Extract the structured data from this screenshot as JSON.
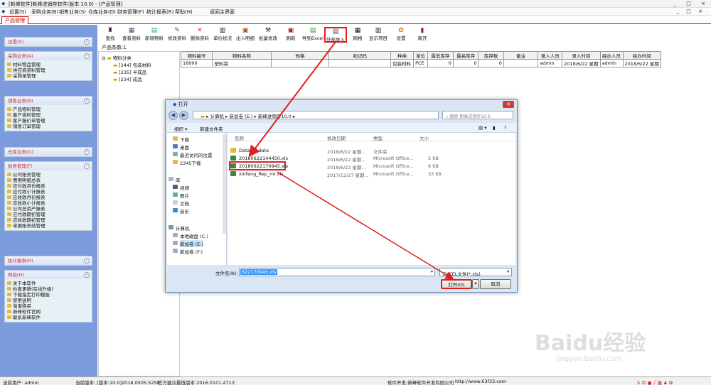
{
  "app": {
    "title": "[新峰软件]新峰进销存软件(版本:10.0) - [产品管理]",
    "window_buttons": "_ □ ×"
  },
  "menu": [
    "设置(S)",
    "采购业务(B)",
    "销售业务(S)",
    "仓库业务(D)",
    "财务管理(F)",
    "统计报表(R)",
    "帮助(H)",
    "返回主界面"
  ],
  "tab": "产品管理",
  "sidebar": {
    "sections": [
      {
        "title": "设置(S)",
        "items": []
      },
      {
        "title": "采购业务(A)",
        "items": [
          "材料物品管理",
          "供应商资料管理",
          "采购单管理"
        ]
      },
      {
        "title": "销售业务(B)",
        "items": [
          "产品物料管理",
          "客户资料管理",
          "客户报价单管理",
          "销售订单管理"
        ]
      },
      {
        "title": "仓库业务(D)",
        "items": []
      },
      {
        "title": "财务管理(F)",
        "items": [
          "公司账务管理",
          "费用明细总表",
          "应付款月份报表",
          "应付款小计报表",
          "应收款月份报表",
          "应收款小计报表",
          "公司总资产报表",
          "应付款期初管理",
          "应收款期初管理",
          "单据账务结管理"
        ]
      },
      {
        "title": "统计报表(R)",
        "items": []
      },
      {
        "title": "帮助(H)",
        "items": [
          "关于本软件",
          "检查更新(在线升级)",
          "下载指定打印模板",
          "使用说明",
          "淘宝购买",
          "新峰软件官网",
          "联系新峰软件"
        ]
      }
    ]
  },
  "toolbar": [
    "查找",
    "查看资料",
    "新增物料",
    "修改资料",
    "删除资料",
    "单价状况",
    "出入明细",
    "批量修改",
    "刷新",
    "导到Excel",
    "外部导入",
    "网格",
    "显示项目",
    "设置",
    "离开"
  ],
  "product_count": "产品条数:1",
  "tree": {
    "root": "物料分类",
    "children": [
      "[244] 包装材料",
      "[235] 半成品",
      "[234] 成品"
    ]
  },
  "grid": {
    "headers": [
      "物料编号",
      "物料名称",
      "规格",
      "助记码",
      "种类",
      "单位",
      "最低库存",
      "最高库存",
      "库存数",
      "备注",
      "录入人员",
      "录入时间",
      "经办人员",
      "经办时间"
    ],
    "rows": [
      [
        "16000",
        "塑料袋",
        "",
        "",
        "包装材料",
        "PCE",
        "0",
        "0",
        "0",
        "",
        "admin",
        "2018/6/22 星期",
        "admin",
        "2018/6/22 星期"
      ]
    ]
  },
  "dialog": {
    "title": "打开",
    "path": [
      "计算机",
      "新加卷 (E:)",
      "新峰进销存10.0"
    ],
    "search_placeholder": "搜索 新峰进销存10.0",
    "organize": "组织 ▾",
    "new_folder": "新建文件夹",
    "nav_items": [
      {
        "label": "下载",
        "kind": "folder"
      },
      {
        "label": "桌面",
        "kind": "desktop"
      },
      {
        "label": "最近访问的位置",
        "kind": "recent"
      },
      {
        "label": "2345下载",
        "kind": "folder"
      },
      {
        "label": "库",
        "kind": "library"
      },
      {
        "label": "视频",
        "kind": "video"
      },
      {
        "label": "图片",
        "kind": "picture"
      },
      {
        "label": "文档",
        "kind": "doc"
      },
      {
        "label": "音乐",
        "kind": "music"
      },
      {
        "label": "计算机",
        "kind": "computer"
      },
      {
        "label": "本地磁盘 (C:)",
        "kind": "drive"
      },
      {
        "label": "新加卷 (E:)",
        "kind": "drive"
      },
      {
        "label": "新加卷 (F:)",
        "kind": "drive"
      }
    ],
    "columns": [
      "名称",
      "修改日期",
      "类型",
      "大小"
    ],
    "files": [
      {
        "name": "Data_Update",
        "date": "2018/6/22 星期...",
        "type": "文件夹",
        "size": "",
        "kind": "folder"
      },
      {
        "name": "20180622144450.xls",
        "date": "2018/6/22 星期...",
        "type": "Microsoft Office...",
        "size": "5 KB",
        "kind": "xls"
      },
      {
        "name": "20180622170945.xls",
        "date": "2018/6/22 星期...",
        "type": "Microsoft Office...",
        "size": "6 KB",
        "kind": "xls"
      },
      {
        "name": "xinfeng_Rep_mr.xls",
        "date": "2017/12/27 星期...",
        "type": "Microsoft Office...",
        "size": "33 KB",
        "kind": "xls"
      }
    ],
    "filename_label": "文件名(N):",
    "filename_value": "622170945.xls",
    "filetype": "EXCEL文件(*.xls)",
    "open_btn": "打开(O)",
    "cancel_btn": "取消"
  },
  "status": {
    "user": "当前用户: admin",
    "version": "当前版本: [版本:10.0]2018.0505.5258",
    "min_version": "官方建议最低版本:2016.0101.4713",
    "dev": "软件开发:新峰软件开发有限公司",
    "url": "http://www.63f33.com"
  },
  "watermark": {
    "main": "Baidu经验",
    "sub": "jingyan.baidu.com"
  },
  "colors": {
    "accent_red": "#e02020",
    "sidebar": "#7b9bdc"
  }
}
